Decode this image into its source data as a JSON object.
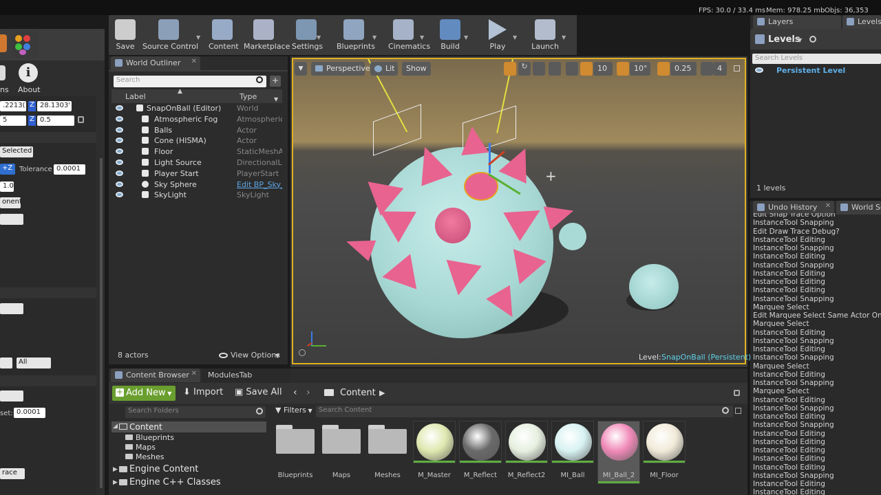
{
  "stats": {
    "fps": "FPS: 30.0 / 33.4 ms",
    "mem": "Mem: 978.25 mb",
    "objs": "Objs: 36,353"
  },
  "toolbar": {
    "items": [
      {
        "label": "Save",
        "icon": "save-icon"
      },
      {
        "label": "Source Control",
        "icon": "source-control-icon"
      },
      {
        "label": "Content",
        "icon": "content-icon"
      },
      {
        "label": "Marketplace",
        "icon": "marketplace-icon"
      },
      {
        "label": "Settings",
        "icon": "settings-icon"
      },
      {
        "label": "Blueprints",
        "icon": "blueprints-icon"
      },
      {
        "label": "Cinematics",
        "icon": "cinematics-icon"
      },
      {
        "label": "Build",
        "icon": "build-icon"
      },
      {
        "label": "Play",
        "icon": "play-icon"
      },
      {
        "label": "Launch",
        "icon": "launch-icon"
      }
    ]
  },
  "left_panel": {
    "about": "About",
    "ns": "ns",
    "z_rot": "28.1303'",
    "x_rot": ".2213(",
    "scale_a": "5",
    "scale_z": "0.5",
    "selected": "Selected",
    "tolerance_label": "Tolerance",
    "tolerance": "0.0001",
    "plus_z": "+Z",
    "val_1": "1.0",
    "onent": "onent",
    "all": "All",
    "set_label": "set:",
    "set_value": "0.0001",
    "trace": "race",
    "z_letter": "Z"
  },
  "outliner": {
    "tab": "World Outliner",
    "search_placeholder": "Search",
    "col_label": "Label",
    "col_type": "Type",
    "rows": [
      {
        "label": "SnapOnBall (Editor)",
        "type": "World"
      },
      {
        "label": "Atmospheric Fog",
        "type": "AtmosphericF"
      },
      {
        "label": "Balls",
        "type": "Actor"
      },
      {
        "label": "Cone (HISMA)",
        "type": "Actor"
      },
      {
        "label": "Floor",
        "type": "StaticMeshAc"
      },
      {
        "label": "Light Source",
        "type": "DirectionalLig"
      },
      {
        "label": "Player Start",
        "type": "PlayerStart"
      },
      {
        "label": "Sky Sphere",
        "type": "Edit BP_Sky_"
      },
      {
        "label": "SkyLight",
        "type": "SkyLight"
      }
    ],
    "count": "8 actors",
    "view_options": "View Options"
  },
  "viewport": {
    "perspective": "Perspective",
    "lit": "Lit",
    "show": "Show",
    "grid": "10",
    "angle": "10°",
    "scale": "0.25",
    "cam": "4",
    "level_label": "Level:",
    "level_name": "SnapOnBall (Persistent)"
  },
  "layers": {
    "tab_layers": "Layers",
    "tab_levels": "Levels",
    "levels_title": "Levels",
    "search_placeholder": "Search Levels",
    "persistent": "Persistent Level",
    "count": "1 levels"
  },
  "history": {
    "tab": "Undo History",
    "tab2": "World Set",
    "items": [
      "Edit Snap Trace Option",
      "InstanceTool Snapping",
      "Edit Draw Trace Debug?",
      "InstanceTool Editing",
      "InstanceTool Snapping",
      "InstanceTool Editing",
      "InstanceTool Snapping",
      "InstanceTool Editing",
      "InstanceTool Editing",
      "InstanceTool Editing",
      "InstanceTool Snapping",
      "Marquee Select",
      "Edit Marquee Select Same Actor Only?",
      "Marquee Select",
      "InstanceTool Editing",
      "InstanceTool Snapping",
      "InstanceTool Editing",
      "InstanceTool Snapping",
      "Marquee Select",
      "InstanceTool Editing",
      "InstanceTool Snapping",
      "Marquee Select",
      "InstanceTool Editing",
      "InstanceTool Snapping",
      "InstanceTool Editing",
      "InstanceTool Snapping",
      "InstanceTool Editing",
      "InstanceTool Editing",
      "InstanceTool Editing",
      "InstanceTool Editing",
      "InstanceTool Editing",
      "InstanceTool Snapping",
      "InstanceTool Editing",
      "InstanceTool Editing"
    ]
  },
  "content_browser": {
    "tab": "Content Browser",
    "tab2": "ModulesTab",
    "add_new": "Add New",
    "import": "Import",
    "save_all": "Save All",
    "path": "Content",
    "search_folders": "Search Folders",
    "filters": "Filters",
    "search_content": "Search Content",
    "tree": [
      {
        "label": "Content",
        "indent": 0
      },
      {
        "label": "Blueprints",
        "indent": 1
      },
      {
        "label": "Maps",
        "indent": 1
      },
      {
        "label": "Meshes",
        "indent": 1
      }
    ],
    "engine_content": "Engine Content",
    "engine_cpp": "Engine C++ Classes",
    "folders": [
      "Blueprints",
      "Maps",
      "Meshes"
    ],
    "assets": [
      {
        "label": "M_Master",
        "color": "#dfe8b0"
      },
      {
        "label": "M_Reflect",
        "color": "#6a6a6a"
      },
      {
        "label": "M_Reflect2",
        "color": "#e6efe0"
      },
      {
        "label": "MI_Ball",
        "color": "#d8f2f2"
      },
      {
        "label": "MI_Ball_2",
        "color": "#f08ab8"
      },
      {
        "label": "MI_Floor",
        "color": "#f0ead8"
      }
    ]
  },
  "colors": {
    "ball": "#a8d8d4",
    "spike": "#e8638f",
    "accent": "#e0b020"
  }
}
